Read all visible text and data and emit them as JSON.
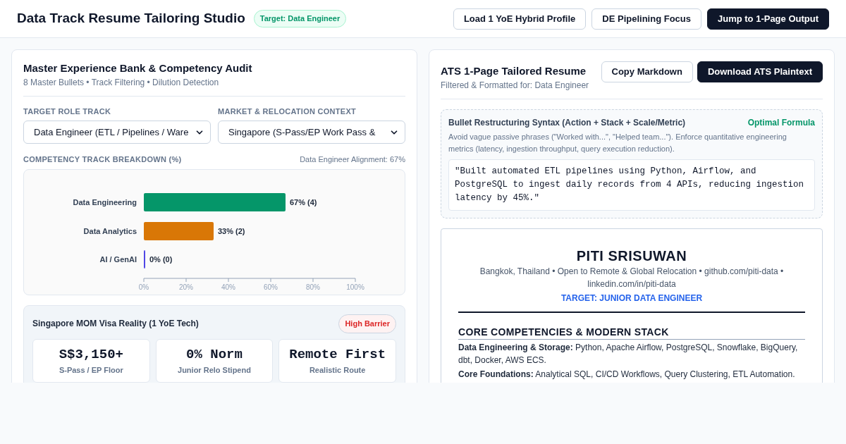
{
  "header": {
    "title": "Data Track Resume Tailoring Studio",
    "badge": "Target: Data Engineer",
    "buttons": [
      {
        "label": "Load 1 YoE Hybrid Profile",
        "kind": "outline"
      },
      {
        "label": "DE Pipelining Focus",
        "kind": "outline"
      },
      {
        "label": "Jump to 1-Page Output",
        "kind": "primary"
      }
    ]
  },
  "audit": {
    "title": "Master Experience Bank & Competency Audit",
    "subtitle": "8 Master Bullets • Track Filtering • Dilution Detection",
    "fields": [
      {
        "label": "TARGET ROLE TRACK",
        "value": "Data Engineer (ETL / Pipelines / Ware"
      },
      {
        "label": "MARKET & RELOCATION CONTEXT",
        "value": "Singapore (S-Pass/EP Work Pass &"
      }
    ],
    "breakdown": {
      "label": "COMPETENCY TRACK BREAKDOWN (%)",
      "alignment": "Data Engineer Alignment: 67%",
      "chart_data": {
        "type": "bar",
        "orientation": "horizontal",
        "categories": [
          "Data Engineering",
          "Data Analytics",
          "AI / GenAI"
        ],
        "series": [
          {
            "values": [
              67,
              33,
              0
            ]
          }
        ],
        "colors": [
          "#059669",
          "#d97706",
          "#4f46e5"
        ],
        "value_labels": [
          "67% (4)",
          "33% (2)",
          "0% (0)"
        ],
        "xlim": [
          0,
          100
        ],
        "xticks": [
          {
            "value": 0,
            "label": "0%"
          },
          {
            "value": 20,
            "label": "20%"
          },
          {
            "value": 40,
            "label": "40%"
          },
          {
            "value": 60,
            "label": "60%"
          },
          {
            "value": 80,
            "label": "80%"
          },
          {
            "value": 100,
            "label": "100%"
          }
        ]
      }
    },
    "visa": {
      "title": "Singapore MOM Visa Reality (1 YoE Tech)",
      "badge": "High Barrier",
      "stats": [
        {
          "value": "S$3,150+",
          "label": "S-Pass / EP Floor"
        },
        {
          "value": "0% Norm",
          "label": "Junior Relo Stipend"
        },
        {
          "value": "Remote First",
          "label": "Realistic Route"
        }
      ]
    }
  },
  "output": {
    "title": "ATS 1-Page Tailored Resume",
    "subtitle": "Filtered & Formatted for: Data Engineer",
    "buttons": [
      {
        "label": "Copy Markdown",
        "kind": "outline"
      },
      {
        "label": "Download ATS Plaintext",
        "kind": "primary"
      }
    ],
    "syntax": {
      "title": "Bullet Restructuring Syntax (Action + Stack + Scale/Metric)",
      "badge": "Optimal Formula",
      "hint": "Avoid vague passive phrases (\"Worked with...\", \"Helped team...\"). Enforce quantitative engineering metrics (latency, ingestion throughput, query execution reduction).",
      "example": "\"Built automated ETL pipelines using Python, Airflow, and PostgreSQL to ingest daily records from 4 APIs, reducing ingestion latency by 45%.\""
    },
    "resume": {
      "name": "PITI SRISUWAN",
      "contact": "Bangkok, Thailand • Open to Remote & Global Relocation • github.com/piti-data • linkedin.com/in/piti-data",
      "target": "TARGET: JUNIOR DATA ENGINEER",
      "section": "CORE COMPETENCIES & MODERN STACK",
      "lines": [
        "**Data Engineering & Storage:** Python, Apache Airflow, PostgreSQL, Snowflake, BigQuery, dbt, Docker, AWS ECS.",
        "**Core Foundations:** Analytical SQL, CI/CD Workflows, Query Clustering, ETL Automation."
      ]
    }
  }
}
